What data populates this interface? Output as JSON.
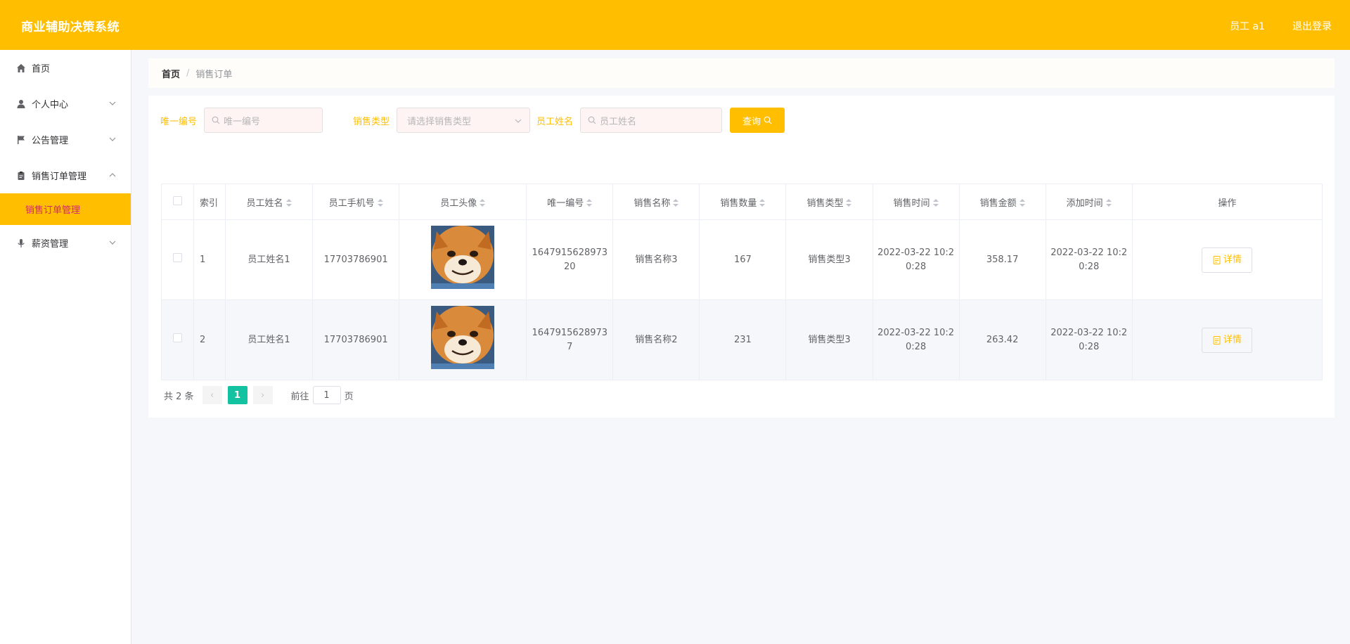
{
  "header": {
    "title": "商业辅助决策系统",
    "user": "员工 a1",
    "logout": "退出登录",
    "bg_color": "#ffbf00"
  },
  "sidebar": {
    "items": [
      {
        "label": "首页",
        "icon": "home-icon"
      },
      {
        "label": "个人中心",
        "icon": "user-icon",
        "expandable": true
      },
      {
        "label": "公告管理",
        "icon": "flag-icon",
        "expandable": true
      },
      {
        "label": "销售订单管理",
        "icon": "clipboard-icon",
        "expandable": true,
        "expanded": true
      },
      {
        "label": "薪资管理",
        "icon": "microphone-icon",
        "expandable": true
      }
    ],
    "active_sub": "销售订单管理"
  },
  "breadcrumb": {
    "home": "首页",
    "separator": "/",
    "current": "销售订单"
  },
  "filters": {
    "id_label": "唯一编号",
    "id_placeholder": "唯一编号",
    "type_label": "销售类型",
    "type_placeholder": "请选择销售类型",
    "name_label": "员工姓名",
    "name_placeholder": "员工姓名",
    "search_button": "查询"
  },
  "table": {
    "columns": {
      "index": "索引",
      "name": "员工姓名",
      "phone": "员工手机号",
      "avatar": "员工头像",
      "uid": "唯一编号",
      "sale_name": "销售名称",
      "qty": "销售数量",
      "sale_type": "销售类型",
      "sale_time": "销售时间",
      "amount": "销售金额",
      "added": "添加时间",
      "action": "操作"
    },
    "rows": [
      {
        "index": "1",
        "name": "员工姓名1",
        "phone": "17703786901",
        "uid": "164791562897320",
        "sale_name": "销售名称3",
        "qty": "167",
        "sale_type": "销售类型3",
        "sale_time": "2022-03-22 10:20:28",
        "amount": "358.17",
        "added": "2022-03-22 10:20:28",
        "action": "详情"
      },
      {
        "index": "2",
        "name": "员工姓名1",
        "phone": "17703786901",
        "uid": "16479156289737",
        "sale_name": "销售名称2",
        "qty": "231",
        "sale_type": "销售类型3",
        "sale_time": "2022-03-22 10:20:28",
        "amount": "263.42",
        "added": "2022-03-22 10:20:28",
        "action": "详情"
      }
    ]
  },
  "pagination": {
    "total": "共 2 条",
    "current_page": "1",
    "goto_prefix": "前往",
    "goto_value": "1",
    "goto_suffix": "页",
    "prev": "‹",
    "next": "›"
  }
}
